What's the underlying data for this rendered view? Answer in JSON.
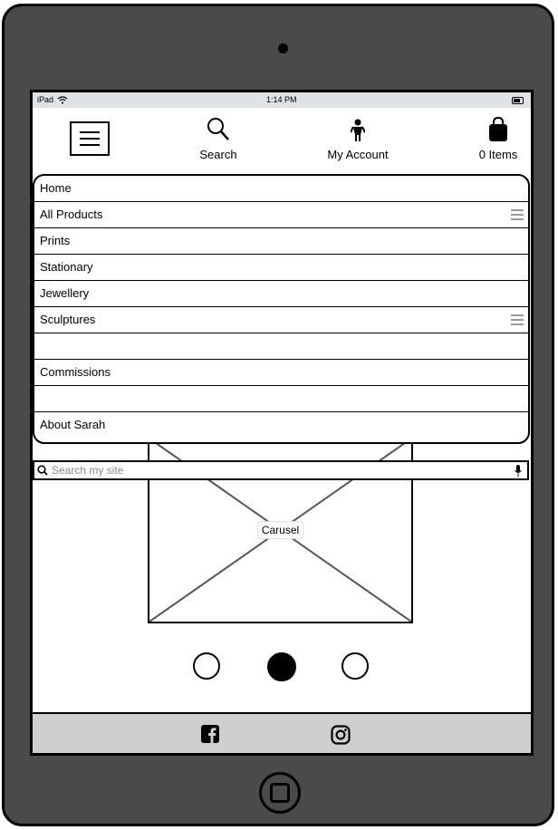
{
  "statusbar": {
    "device": "iPad",
    "time": "1:14 PM"
  },
  "header": {
    "search_label": "Search",
    "account_label": "My Account",
    "cart_label": "0 Items"
  },
  "menu": {
    "items": [
      "Home",
      "All Products",
      "Prints",
      "Stationary",
      "Jewellery",
      "Sculptures",
      "",
      "Commissions",
      "",
      "About Sarah"
    ]
  },
  "search": {
    "placeholder": "Search my site"
  },
  "carousel": {
    "label": "Carusel",
    "active_dot": 2,
    "dot_count": 3
  },
  "footer": {
    "icons": [
      "facebook-icon",
      "instagram-icon"
    ]
  }
}
